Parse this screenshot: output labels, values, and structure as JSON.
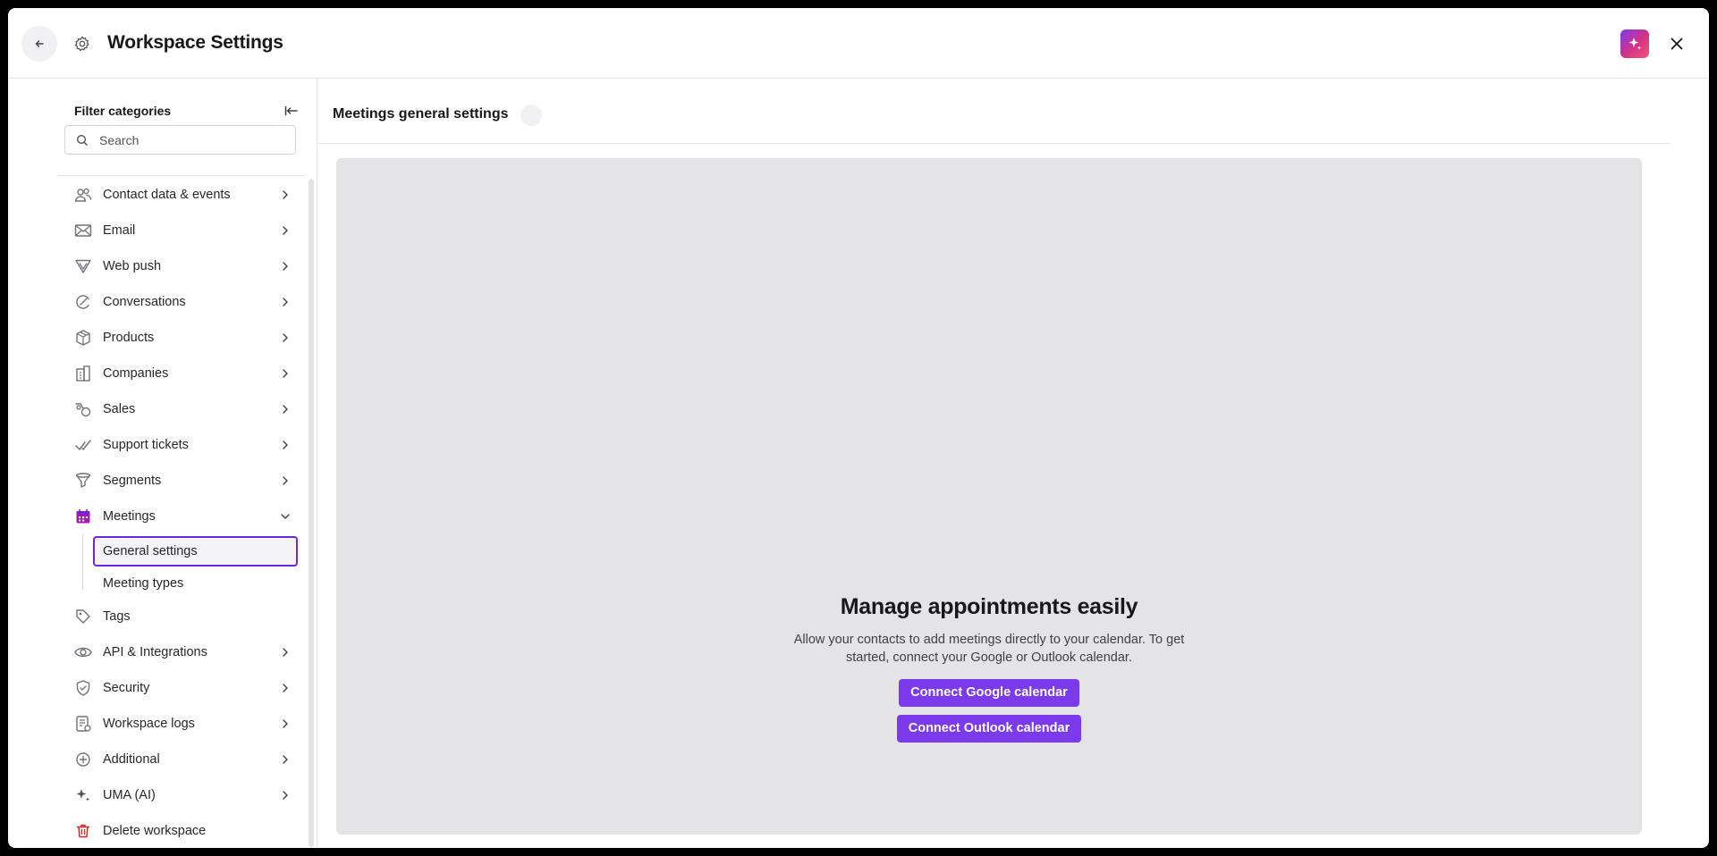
{
  "header": {
    "title": "Workspace Settings"
  },
  "sidebar": {
    "filter_title": "Filter categories",
    "search_placeholder": "Search",
    "items": [
      {
        "label": "Contact data & events",
        "icon": "contacts-icon"
      },
      {
        "label": "Email",
        "icon": "email-icon"
      },
      {
        "label": "Web push",
        "icon": "web-push-icon"
      },
      {
        "label": "Conversations",
        "icon": "conversations-icon"
      },
      {
        "label": "Products",
        "icon": "products-icon"
      },
      {
        "label": "Companies",
        "icon": "companies-icon"
      },
      {
        "label": "Sales",
        "icon": "sales-icon"
      },
      {
        "label": "Support tickets",
        "icon": "support-tickets-icon"
      },
      {
        "label": "Segments",
        "icon": "segments-icon"
      },
      {
        "label": "Meetings",
        "icon": "calendar-icon",
        "expanded": true,
        "children": [
          {
            "label": "General settings",
            "active": true
          },
          {
            "label": "Meeting types"
          }
        ]
      },
      {
        "label": "Tags",
        "icon": "tags-icon"
      },
      {
        "label": "API & Integrations",
        "icon": "api-icon"
      },
      {
        "label": "Security",
        "icon": "security-icon"
      },
      {
        "label": "Workspace logs",
        "icon": "logs-icon"
      },
      {
        "label": "Additional",
        "icon": "additional-icon"
      },
      {
        "label": "UMA (AI)",
        "icon": "sparkles-icon"
      },
      {
        "label": "Delete workspace",
        "icon": "trash-icon"
      }
    ]
  },
  "main": {
    "title": "Meetings general settings",
    "empty_state": {
      "heading": "Manage appointments easily",
      "description": "Allow your contacts to add meetings directly to your calendar. To get started, connect your Google or Outlook calendar.",
      "google_button": "Connect Google calendar",
      "outlook_button": "Connect Outlook calendar"
    }
  },
  "colors": {
    "accent": "#7c3aed",
    "panel_bg": "#e4e4e7",
    "delete_red": "#dc2626",
    "meetings_purple": "#a21caf"
  }
}
